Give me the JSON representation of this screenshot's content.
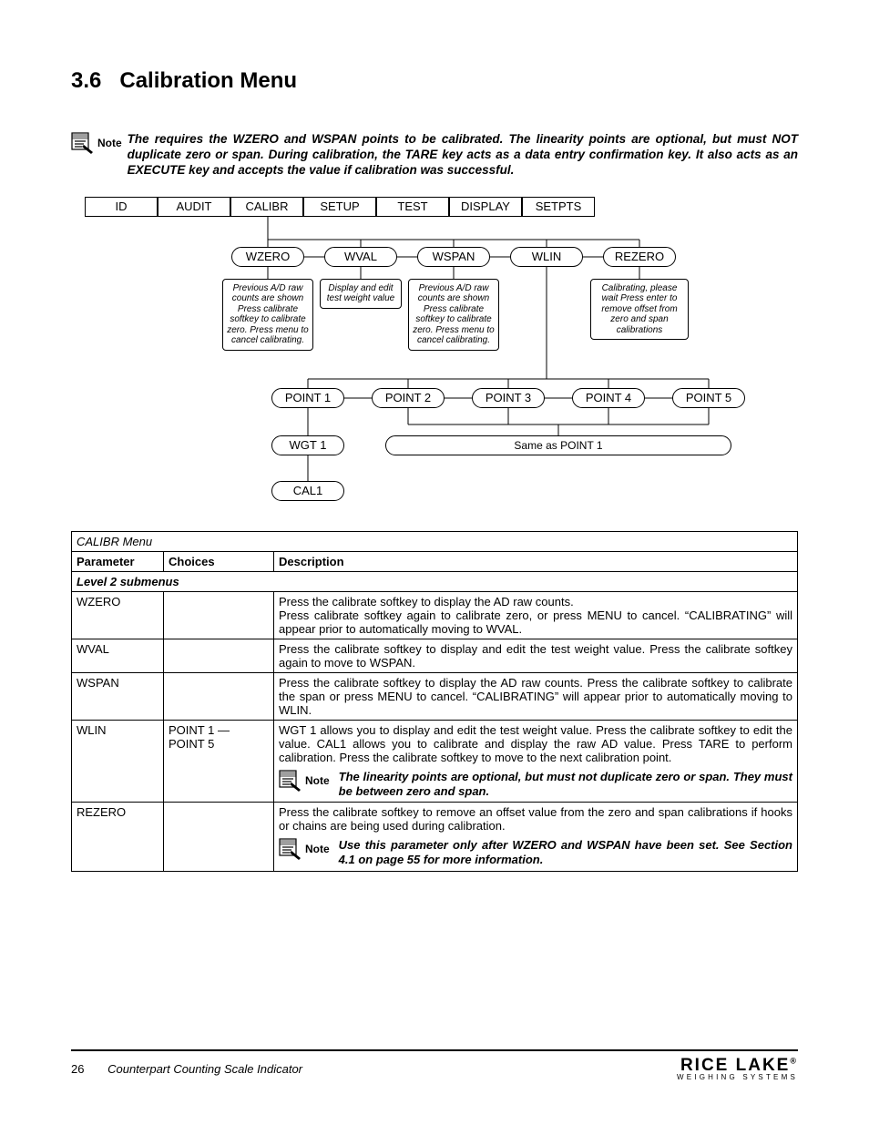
{
  "heading": {
    "number": "3.6",
    "title": "Calibration Menu"
  },
  "top_note": {
    "label": "Note",
    "text": "The                    requires the WZERO and WSPAN points to be calibrated. The linearity points are optional, but must NOT duplicate zero or span. During calibration, the TARE key acts as a data entry confirmation key. It also acts as an EXECUTE key and accepts the value if calibration was successful."
  },
  "diagram": {
    "top_tabs": [
      "ID",
      "AUDIT",
      "CALIBR",
      "SETUP",
      "TEST",
      "DISPLAY",
      "SETPTS"
    ],
    "sub_tabs": [
      "WZERO",
      "WVAL",
      "WSPAN",
      "WLIN",
      "REZERO"
    ],
    "cap_wzero": "Previous A/D raw counts are shown Press calibrate softkey to calibrate zero. Press menu to cancel calibrating.",
    "cap_wval": "Display and edit test weight value",
    "cap_wspan": "Previous A/D raw counts are shown Press calibrate softkey to calibrate zero. Press menu to cancel calibrating.",
    "cap_rezero": "Calibrating, please wait Press enter to remove offset from zero and span calibrations",
    "points": [
      "POINT 1",
      "POINT 2",
      "POINT 3",
      "POINT 4",
      "POINT 5"
    ],
    "wgt1": "WGT 1",
    "same_as": "Same as POINT 1",
    "cal1": "CAL1"
  },
  "table": {
    "title": "CALIBR Menu",
    "headers": [
      "Parameter",
      "Choices",
      "Description"
    ],
    "subheader": "Level 2 submenus",
    "rows": [
      {
        "param": "WZERO",
        "choices": "",
        "desc": "Press the calibrate softkey to display the AD raw counts.\nPress calibrate softkey again to calibrate zero, or press MENU to cancel. “CALIBRATING” will appear prior to automatically moving to WVAL."
      },
      {
        "param": "WVAL",
        "choices": "",
        "desc": "Press the calibrate softkey to display and edit the test weight value. Press the calibrate softkey again to move to WSPAN."
      },
      {
        "param": "WSPAN",
        "choices": "",
        "desc": "Press the calibrate softkey to display the AD raw counts. Press the calibrate softkey to calibrate the span or press MENU to cancel. “CALIBRATING” will appear prior to automatically moving to WLIN."
      },
      {
        "param": "WLIN",
        "choices": "POINT 1 — POINT 5",
        "desc": "WGT 1 allows you to display and edit the test weight value. Press the calibrate softkey to edit the value. CAL1 allows you to calibrate and display the raw AD value. Press TARE to perform calibration. Press the calibrate softkey to move to the next calibration point.",
        "note": "The linearity points are optional, but must not duplicate zero or span. They must be between zero and span."
      },
      {
        "param": "REZERO",
        "choices": "",
        "desc": "Press the calibrate softkey to remove an offset value from the zero and span calibrations if hooks or chains are being used during calibration.",
        "note": "Use this parameter only after WZERO and WSPAN have been set. See Section 4.1 on page 55 for more information."
      }
    ],
    "note_label": "Note"
  },
  "footer": {
    "page": "26",
    "doc": "Counterpart Counting Scale Indicator",
    "brand1": "RICE LAKE",
    "brand2": "WEIGHING SYSTEMS"
  }
}
